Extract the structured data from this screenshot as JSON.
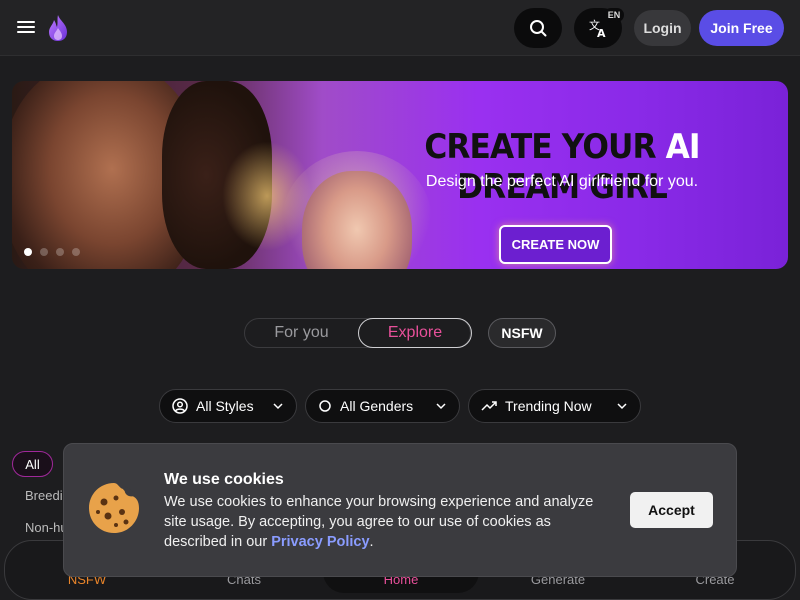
{
  "header": {
    "menu_icon": "hamburger-icon",
    "logo_icon": "flame-logo-icon",
    "search_icon": "search-icon",
    "language_icon": "translate-icon",
    "language_code": "EN",
    "login_label": "Login",
    "join_label": "Join Free",
    "join_color": "#5a4de6"
  },
  "banner": {
    "title_before": "CREATE YOUR ",
    "title_highlight": "AI",
    "title_after": " DREAM GIRL",
    "subtitle": "Design the perfect AI girlfriend for you.",
    "cta_label": "CREATE NOW",
    "slide_count": 4,
    "active_slide": 1
  },
  "tabs": {
    "items": [
      {
        "label": "For you",
        "active": false
      },
      {
        "label": "Explore",
        "active": true
      }
    ],
    "nsfw_label": "NSFW",
    "active_color": "#e8509a"
  },
  "filters": [
    {
      "label": "All Styles",
      "icon": "user-circle-icon"
    },
    {
      "label": "All Genders",
      "icon": "circle-icon"
    },
    {
      "label": "Trending Now",
      "icon": "trending-up-icon"
    }
  ],
  "categories": {
    "all_label": "All",
    "visible_items": [
      "Breedi",
      "Non-hu"
    ]
  },
  "cookie": {
    "icon": "cookie-icon",
    "title": "We use cookies",
    "body": "We use cookies to enhance your browsing experience and analyze site usage. By accepting, you agree to our use of cookies as described in our ",
    "link_label": "Privacy Policy",
    "body_end": ".",
    "accept_label": "Accept"
  },
  "bottom_nav": {
    "items": [
      {
        "label": "NSFW",
        "color": "#e8842a"
      },
      {
        "label": "Chats",
        "color": "#9a9a9e"
      },
      {
        "label": "Home",
        "color": "#e8509a"
      },
      {
        "label": "Generate",
        "color": "#9a9a9e"
      },
      {
        "label": "Create",
        "color": "#9a9a9e"
      }
    ]
  }
}
